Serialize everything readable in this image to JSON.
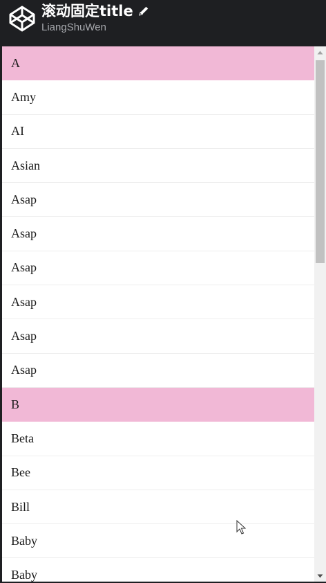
{
  "header": {
    "title": "滚动固定title",
    "author": "LiangShuWen",
    "logo_icon": "codepen-logo-icon",
    "edit_icon": "pencil-icon"
  },
  "list": {
    "rows": [
      {
        "text": "A",
        "group": true
      },
      {
        "text": "Amy",
        "group": false
      },
      {
        "text": "AI",
        "group": false
      },
      {
        "text": "Asian",
        "group": false
      },
      {
        "text": "Asap",
        "group": false
      },
      {
        "text": "Asap",
        "group": false
      },
      {
        "text": "Asap",
        "group": false
      },
      {
        "text": "Asap",
        "group": false
      },
      {
        "text": "Asap",
        "group": false
      },
      {
        "text": "Asap",
        "group": false
      },
      {
        "text": "B",
        "group": true
      },
      {
        "text": "Beta",
        "group": false
      },
      {
        "text": "Bee",
        "group": false
      },
      {
        "text": "Bill",
        "group": false
      },
      {
        "text": "Baby",
        "group": false
      },
      {
        "text": "Baby",
        "group": false
      }
    ]
  },
  "colors": {
    "header_bg": "#1e1f22",
    "group_bg": "#f1b8d6",
    "row_bg": "#ffffff",
    "scrollbar_thumb": "#c1c1c1"
  }
}
